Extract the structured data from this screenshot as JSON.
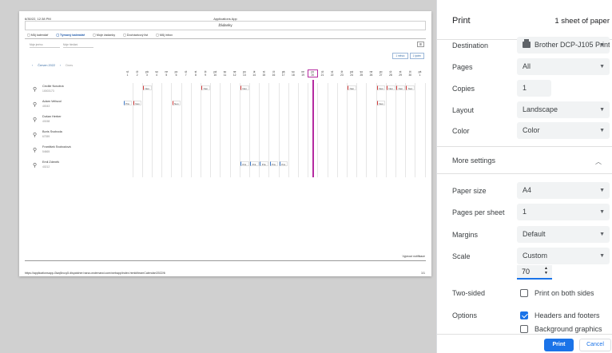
{
  "preview": {
    "header_datetime": "6/30/22, 12:38 PM",
    "header_title": "Applications App",
    "app_heading": "Žádanky",
    "tabs": [
      {
        "label": "Můj kalendář",
        "active": false
      },
      {
        "label": "Týmový kalendář",
        "active": true
      },
      {
        "label": "Moje žádanky",
        "active": false
      },
      {
        "label": "Docházkový list",
        "active": false
      },
      {
        "label": "Můj inbox",
        "active": false
      }
    ],
    "filter_name_placeholder": "Moje jméno",
    "filter_search_placeholder": "Moje hledání",
    "view_month": "1 měsíc",
    "view_week": "1 týden",
    "nav_month": "Červen 2022",
    "nav_today": "Dnes",
    "days": [
      {
        "wd": "st",
        "d": "1"
      },
      {
        "wd": "čt",
        "d": "2"
      },
      {
        "wd": "pá",
        "d": "3"
      },
      {
        "wd": "so",
        "d": "4"
      },
      {
        "wd": "ne",
        "d": "5"
      },
      {
        "wd": "po",
        "d": "6"
      },
      {
        "wd": "út",
        "d": "7"
      },
      {
        "wd": "st",
        "d": "8"
      },
      {
        "wd": "čt",
        "d": "9"
      },
      {
        "wd": "pá",
        "d": "10"
      },
      {
        "wd": "so",
        "d": "11"
      },
      {
        "wd": "ne",
        "d": "12"
      },
      {
        "wd": "po",
        "d": "13"
      },
      {
        "wd": "út",
        "d": "14"
      },
      {
        "wd": "st",
        "d": "15"
      },
      {
        "wd": "čt",
        "d": "16"
      },
      {
        "wd": "pá",
        "d": "17"
      },
      {
        "wd": "so",
        "d": "18"
      },
      {
        "wd": "ne",
        "d": "19"
      },
      {
        "wd": "po",
        "d": "20"
      },
      {
        "wd": "út",
        "d": "21"
      },
      {
        "wd": "st",
        "d": "22"
      },
      {
        "wd": "čt",
        "d": "23"
      },
      {
        "wd": "pá",
        "d": "24"
      },
      {
        "wd": "so",
        "d": "25"
      },
      {
        "wd": "ne",
        "d": "26"
      },
      {
        "wd": "po",
        "d": "27"
      },
      {
        "wd": "út",
        "d": "28"
      },
      {
        "wd": "st",
        "d": "29"
      },
      {
        "wd": "čt",
        "d": "30"
      },
      {
        "wd": "pá",
        "d": "1"
      }
    ],
    "today_index": 19,
    "employees": [
      {
        "name": "Cecilie Novotná",
        "id": "10003173",
        "events": [
          {
            "day": 3,
            "label": "Nep",
            "color": "red"
          },
          {
            "day": 9,
            "label": "Nep",
            "color": "red"
          },
          {
            "day": 13,
            "label": "Nep",
            "color": "red"
          },
          {
            "day": 24,
            "label": "Nep",
            "color": "red"
          },
          {
            "day": 27,
            "label": "Nep",
            "color": "red"
          },
          {
            "day": 28,
            "label": "Nep",
            "color": "red"
          },
          {
            "day": 29,
            "label": "Nep",
            "color": "red"
          },
          {
            "day": 30,
            "label": "Nep",
            "color": "red"
          }
        ]
      },
      {
        "name": "Adam Veliscol",
        "id": "40043",
        "events": [
          {
            "day": 1,
            "label": "Prá",
            "color": "blue"
          },
          {
            "day": 2,
            "label": "Nep",
            "color": "red"
          },
          {
            "day": 6,
            "label": "Nep",
            "color": "red"
          },
          {
            "day": 27,
            "label": "Nep",
            "color": "red"
          }
        ]
      },
      {
        "name": "Dušan Herber",
        "id": "40158",
        "events": []
      },
      {
        "name": "Boris Svoboda",
        "id": "67059",
        "events": []
      },
      {
        "name": "František Svobodová",
        "id": "54665",
        "events": []
      },
      {
        "name": "Emil Zdeněk",
        "id": "40212",
        "events": [
          {
            "day": 13,
            "label": "Prá",
            "color": "blue"
          },
          {
            "day": 14,
            "label": "Prá",
            "color": "blue"
          },
          {
            "day": 15,
            "label": "Prá",
            "color": "blue"
          },
          {
            "day": 16,
            "label": "Prá",
            "color": "blue"
          },
          {
            "day": 17,
            "label": "Prá",
            "color": "blue"
          }
        ]
      }
    ],
    "footer_note": "Vypnout notifikace",
    "footer_url": "https://applicationsapp-i3wq5rcuy5.dispatcher.hana.ondemand.com/webapp/index.html#/teamCalendar/2022/6",
    "footer_page": "1/1"
  },
  "panel": {
    "title": "Print",
    "sheets": "1 sheet of paper",
    "destination_label": "Destination",
    "destination_value": "Brother DCP-J105 Printer",
    "pages_label": "Pages",
    "pages_value": "All",
    "copies_label": "Copies",
    "copies_value": "1",
    "layout_label": "Layout",
    "layout_value": "Landscape",
    "color_label": "Color",
    "color_value": "Color",
    "more_settings_label": "More settings",
    "paper_size_label": "Paper size",
    "paper_size_value": "A4",
    "pages_per_sheet_label": "Pages per sheet",
    "pages_per_sheet_value": "1",
    "margins_label": "Margins",
    "margins_value": "Default",
    "scale_label": "Scale",
    "scale_value": "Custom",
    "scale_input_value": "70",
    "two_sided_label": "Two-sided",
    "two_sided_option": "Print on both sides",
    "options_label": "Options",
    "option_headers": "Headers and footers",
    "option_background": "Background graphics",
    "print_button": "Print",
    "cancel_button": "Cancel"
  },
  "colors": {
    "accent": "#1a73e8",
    "today_marker": "#b52aa0",
    "event_red": "#d23b3b",
    "event_blue": "#3a77c8"
  }
}
